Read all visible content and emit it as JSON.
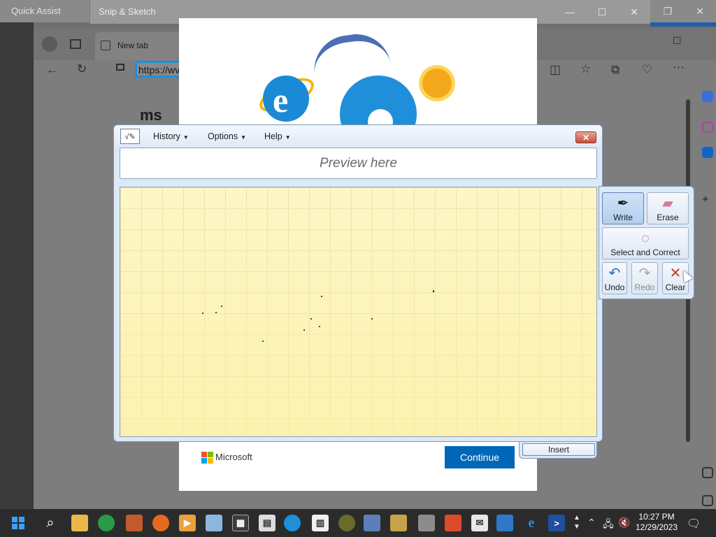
{
  "quick_assist": {
    "title": "Quick Assist"
  },
  "snip": {
    "title": "Snip & Sketch"
  },
  "browser": {
    "tab_label": "New tab",
    "address_value": "https://wv",
    "page_brand": "ms"
  },
  "page": {
    "footer_brand": "Microsoft",
    "continue_label": "Continue"
  },
  "tip": {
    "menus": [
      "History",
      "Options",
      "Help"
    ],
    "preview_placeholder": "Preview here",
    "tools": {
      "write": "Write",
      "erase": "Erase",
      "select_correct": "Select and Correct",
      "undo": "Undo",
      "redo": "Redo",
      "clear": "Clear"
    },
    "insert_label": "Insert"
  },
  "taskbar": {
    "time": "10:27 PM",
    "date": "12/29/2023"
  },
  "colors": {
    "accent": "#0067b8",
    "focus_outline": "#1a8fe3",
    "pad": "#fdf6c6"
  }
}
